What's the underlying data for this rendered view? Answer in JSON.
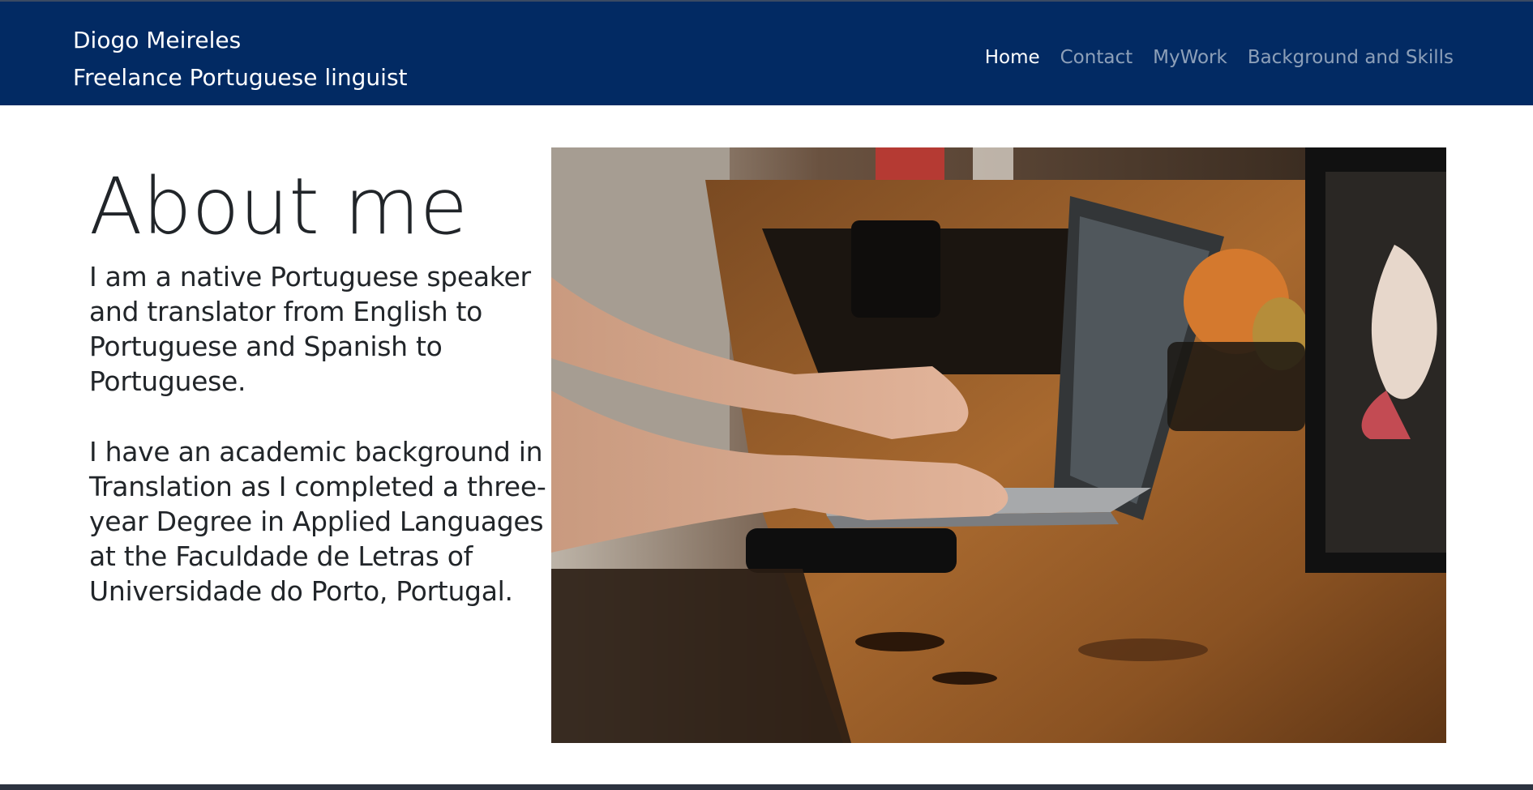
{
  "brand": {
    "name": "Diogo Meireles",
    "tagline": "Freelance Portuguese linguist"
  },
  "nav": {
    "items": [
      "Home",
      "Contact",
      "MyWork",
      "Background and Skills"
    ],
    "active": "Home"
  },
  "about": {
    "heading": "About me",
    "paragraph_1": "I am a native Portuguese speaker and translator from English to Portuguese and Spanish to Portuguese.",
    "paragraph_2": "I have an academic background in Translation as I completed a three-year Degree in Applied Languages at the Faculdade de Letras of Universidade do Porto, Portugal."
  },
  "colors": {
    "navbar": "#022a63",
    "nav_active": "#ffffff",
    "nav_inactive": "rgba(255,255,255,0.55)",
    "text": "#212529"
  },
  "image": {
    "subject": "Hands typing on a laptop on a wooden table in a café"
  }
}
